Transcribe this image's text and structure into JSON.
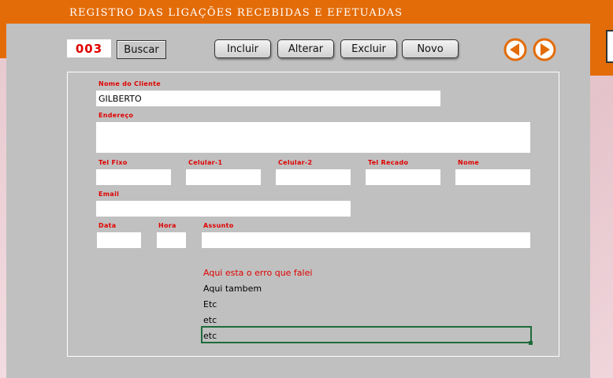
{
  "app": {
    "title": "REGISTRO DAS LIGAÇÕES RECEBIDAS E EFETUADAS"
  },
  "toolbar": {
    "record_id": "003",
    "buscar": "Buscar",
    "incluir": "Incluir",
    "alterar": "Alterar",
    "excluir": "Excluir",
    "novo": "Novo"
  },
  "form": {
    "nome_cliente": {
      "label": "Nome do Cliente",
      "value": "GILBERTO"
    },
    "endereco": {
      "label": "Endereço",
      "value": ""
    },
    "tel_fixo": {
      "label": "Tel Fixo",
      "value": ""
    },
    "celular1": {
      "label": "Celular-1",
      "value": ""
    },
    "celular2": {
      "label": "Celular-2",
      "value": ""
    },
    "tel_recado": {
      "label": "Tel Recado",
      "value": ""
    },
    "nome": {
      "label": "Nome",
      "value": ""
    },
    "email": {
      "label": "Email",
      "value": ""
    },
    "data": {
      "label": "Data",
      "value": ""
    },
    "hora": {
      "label": "Hora",
      "value": ""
    },
    "assunto": {
      "label": "Assunto",
      "value": ""
    }
  },
  "notes": [
    "Aqui esta o erro que falei",
    "Aqui tambem",
    "Etc",
    "etc",
    "etc"
  ],
  "colors": {
    "accent": "#e36c09",
    "label": "#e00000",
    "panel": "#c0c0c0"
  },
  "icons": {
    "prev": "arrow-left-circle-icon",
    "next": "arrow-right-circle-icon"
  }
}
